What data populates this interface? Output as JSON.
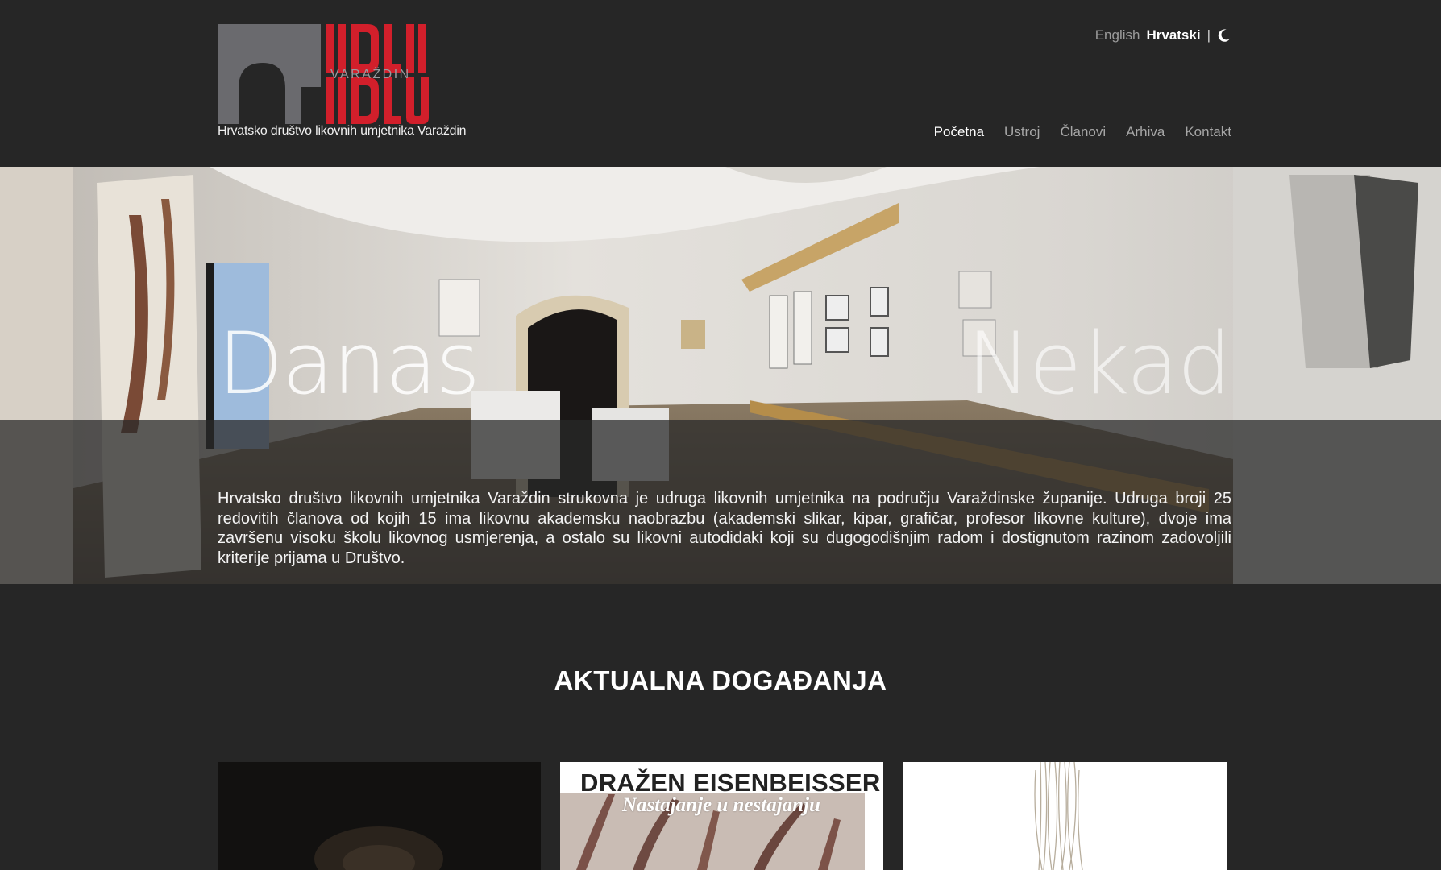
{
  "header": {
    "logo_word": "VARAŽDIN",
    "logo_subtitle": "Hrvatsko društvo likovnih umjetnika Varaždin",
    "languages": {
      "english": "English",
      "croatian": "Hrvatski",
      "separator": "|"
    },
    "theme_icon": "moon-icon",
    "nav": [
      {
        "label": "Početna",
        "active": true
      },
      {
        "label": "Ustroj",
        "active": false
      },
      {
        "label": "Članovi",
        "active": false
      },
      {
        "label": "Arhiva",
        "active": false
      },
      {
        "label": "Kontakt",
        "active": false
      }
    ]
  },
  "hero": {
    "left_word": "Danas",
    "right_word": "Nekad",
    "intro": "Hrvatsko društvo likovnih umjetnika Varaždin strukovna je udruga likovnih umjetnika na području Varaždinske županije. Udruga broji 25 redovitih članova od kojih 15 ima likovnu akademsku naobrazbu (akademski slikar, kipar, grafičar, profesor likovne kulture), dvoje ima završenu visoku školu likovnog usmjerenja, a ostalo su likovni autodidaki koji su dugogodišnjim radom i dostignutom razinom zadovoljili kriterije prijama u Društvo."
  },
  "events": {
    "title": "AKTUALNA DOGAĐANJA",
    "cards": [
      {
        "title": "",
        "subtitle": ""
      },
      {
        "title": "DRAŽEN EISENBEISSER",
        "subtitle": "Nastajanje u nestajanju"
      },
      {
        "title": "",
        "subtitle": ""
      }
    ]
  },
  "colors": {
    "background": "#262626",
    "logo_red": "#d21f2b",
    "logo_grey": "#6a6a6e",
    "nav_inactive": "#a6a6a6",
    "nav_active": "#ffffff"
  }
}
